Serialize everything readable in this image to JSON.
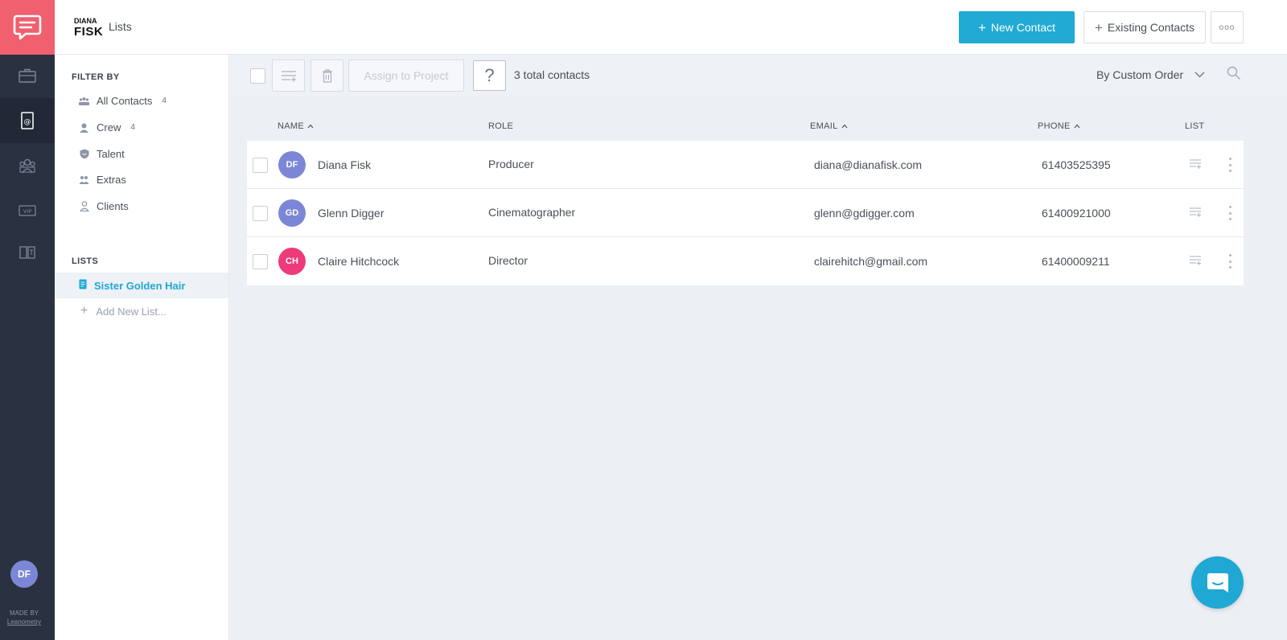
{
  "brand": {
    "line1": "DIANA",
    "line2": "FISK"
  },
  "header": {
    "title": "Lists",
    "new_contact_label": "New Contact",
    "existing_contacts_label": "Existing Contacts"
  },
  "rail": {
    "avatar_initials": "DF",
    "made_by": "MADE BY",
    "made_by_company": "Leanometry",
    "vip_label": "VIP"
  },
  "filters": {
    "title": "FILTER BY",
    "items": [
      {
        "label": "All Contacts",
        "count": "4",
        "icon": "group-icon"
      },
      {
        "label": "Crew",
        "count": "4",
        "icon": "crew-icon"
      },
      {
        "label": "Talent",
        "count": "",
        "icon": "talent-shield-icon"
      },
      {
        "label": "Extras",
        "count": "",
        "icon": "extras-icon"
      },
      {
        "label": "Clients",
        "count": "",
        "icon": "client-icon"
      }
    ]
  },
  "lists": {
    "title": "LISTS",
    "items": [
      {
        "label": "Sister Golden Hair"
      }
    ],
    "add_label": "Add New List..."
  },
  "toolbar": {
    "assign_label": "Assign to Project",
    "help_label": "?",
    "total_label": "3 total contacts",
    "sort_label": "By Custom Order"
  },
  "table": {
    "columns": {
      "name": "NAME",
      "role": "ROLE",
      "email": "EMAIL",
      "phone": "PHONE",
      "list": "LIST"
    },
    "rows": [
      {
        "initials": "DF",
        "avatar_color": "#7b87d6",
        "name": "Diana Fisk",
        "role": "Producer",
        "email": "diana@dianafisk.com",
        "phone": "61403525395"
      },
      {
        "initials": "GD",
        "avatar_color": "#7b87d6",
        "name": "Glenn Digger",
        "role": "Cinematographer",
        "email": "glenn@gdigger.com",
        "phone": "61400921000"
      },
      {
        "initials": "CH",
        "avatar_color": "#ee3a7a",
        "name": "Claire Hitchcock",
        "role": "Director",
        "email": "clairehitch@gmail.com",
        "phone": "61400009211"
      }
    ]
  },
  "colors": {
    "accent": "#21aad4",
    "logo_bg": "#f0606e",
    "rail_bg": "#2a3140"
  }
}
